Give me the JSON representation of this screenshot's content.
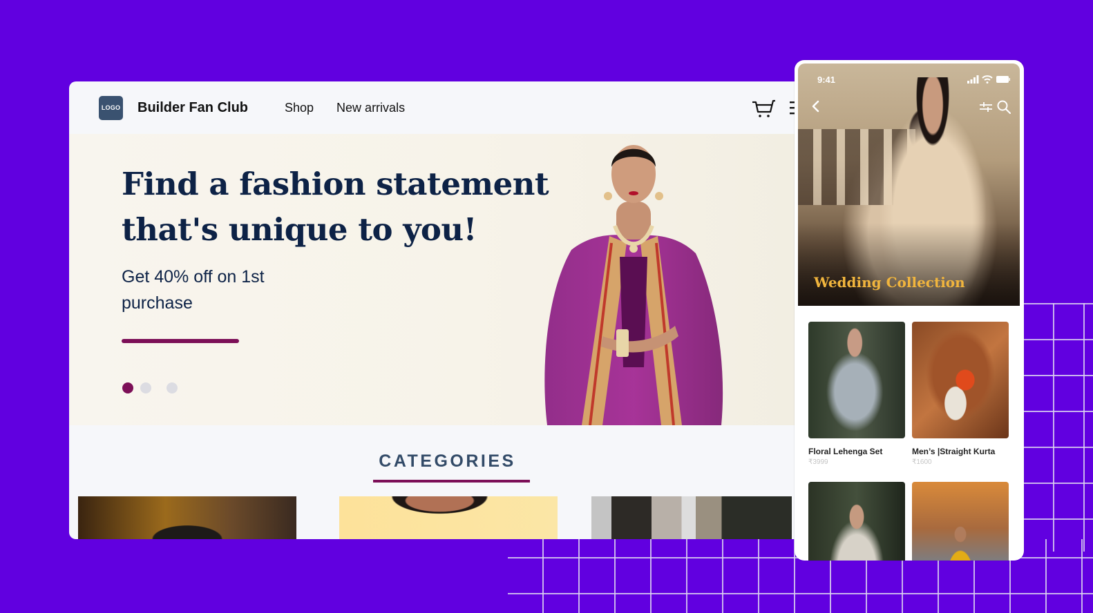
{
  "desktop": {
    "nav": {
      "logo_text": "LOGO",
      "brand": "Builder Fan Club",
      "links": [
        "Shop",
        "New arrivals"
      ],
      "icons": [
        "cart-icon",
        "menu-icon"
      ]
    },
    "hero": {
      "title": "Find a fashion statement that's unique to you!",
      "subtitle": "Get 40% off on 1st purchase",
      "carousel": {
        "total": 3,
        "active": 1
      }
    },
    "categories": {
      "title": "CATEGORIES"
    }
  },
  "phone": {
    "status": {
      "time": "9:41"
    },
    "icons": [
      "back-icon",
      "filter-icon",
      "search-icon"
    ],
    "collection_title": "Wedding Collection",
    "products": [
      {
        "name": "Floral Lehenga Set",
        "price": "₹3999"
      },
      {
        "name": "Men’s |Straight Kurta",
        "price": "₹1600"
      },
      {
        "name": "",
        "price": ""
      },
      {
        "name": "",
        "price": ""
      }
    ]
  },
  "colors": {
    "background": "#6100e0",
    "accent": "#7c0f57",
    "heading": "#0d2246",
    "collection_title": "#f1b53d"
  }
}
